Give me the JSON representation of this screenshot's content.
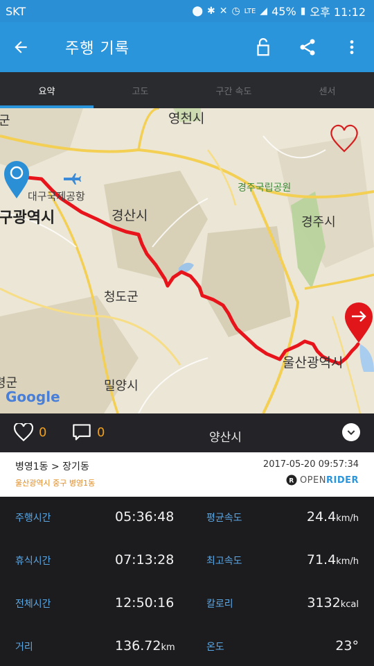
{
  "status_bar": {
    "carrier": "SKT",
    "network": "LTE",
    "battery": "45%",
    "time": "오후 11:12"
  },
  "app_bar": {
    "title": "주행 기록",
    "back_icon": "arrow-left-icon",
    "lock_icon": "unlock-icon",
    "share_icon": "share-icon",
    "menu_icon": "more-vert-icon"
  },
  "tabs": [
    {
      "label": "요약",
      "active": true
    },
    {
      "label": "고도",
      "active": false
    },
    {
      "label": "구간 속도",
      "active": false
    },
    {
      "label": "센서",
      "active": false
    }
  ],
  "map": {
    "labels": {
      "yeongcheon": "영천시",
      "daegu_airport": "대구국제공항",
      "daegu": "대구광역시",
      "gyeongsan": "경산시",
      "gyeongju_park": "경주국립공원",
      "gyeongju": "경주시",
      "cheongdo": "청도군",
      "ulsan": "울산광역시",
      "miryang": "밀양시",
      "yangsan": "양산시",
      "gun_left": "군",
      "gun_left2": "령군"
    },
    "google_logo": "Google",
    "route_color": "#e8141b",
    "start_marker_color": "#2b8fd6",
    "end_marker_color": "#e0161b"
  },
  "social": {
    "likes": "0",
    "comments": "0"
  },
  "ride": {
    "route": "병영1동 > 장기동",
    "address": "울산광역시 중구 병영1동",
    "datetime": "2017-05-20 09:57:34",
    "brand_open": "OPEN",
    "brand_rider": "RIDER"
  },
  "stats": {
    "ride_time_label": "주행시간",
    "ride_time": "05:36:48",
    "rest_time_label": "휴식시간",
    "rest_time": "07:13:28",
    "total_time_label": "전체시간",
    "total_time": "12:50:16",
    "distance_label": "거리",
    "distance_value": "136.72",
    "distance_unit": "km",
    "avg_speed_label": "평균속도",
    "avg_speed_value": "24.4",
    "avg_speed_unit": "km/h",
    "max_speed_label": "최고속도",
    "max_speed_value": "71.4",
    "max_speed_unit": "km/h",
    "calorie_label": "칼로리",
    "calorie_value": "3132",
    "calorie_unit": "kcal",
    "temp_label": "온도",
    "temp_value": "23°"
  }
}
